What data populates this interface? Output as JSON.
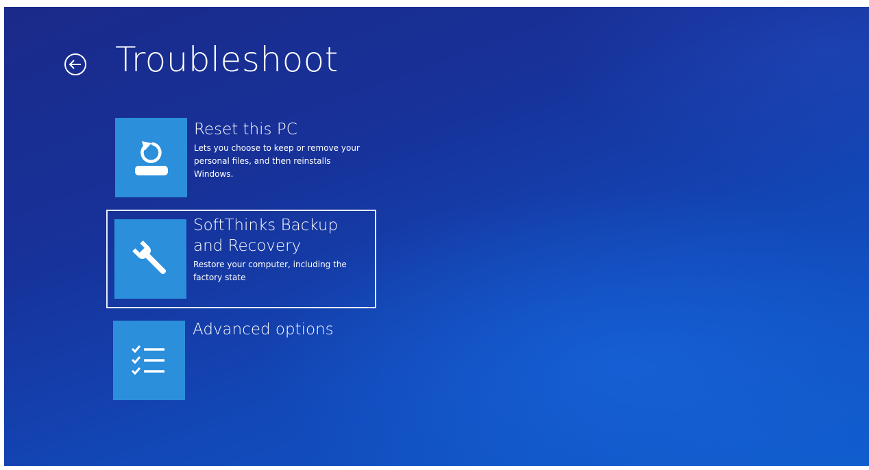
{
  "page": {
    "title": "Troubleshoot"
  },
  "options": [
    {
      "id": "reset",
      "title": "Reset this PC",
      "description": "Lets you choose to keep or remove your personal files, and then reinstalls Windows.",
      "icon": "reset-drive-icon"
    },
    {
      "id": "backup",
      "title": "SoftThinks Backup and Recovery",
      "description": "Restore your computer, including the factory state",
      "icon": "wrench-icon",
      "selected": true
    },
    {
      "id": "advanced",
      "title": "Advanced options",
      "description": "",
      "icon": "checklist-icon"
    }
  ],
  "colors": {
    "background": "#1742a8",
    "tile": "#2b8fdc",
    "text": "#ffffff",
    "selection_border": "#e8eefc"
  }
}
